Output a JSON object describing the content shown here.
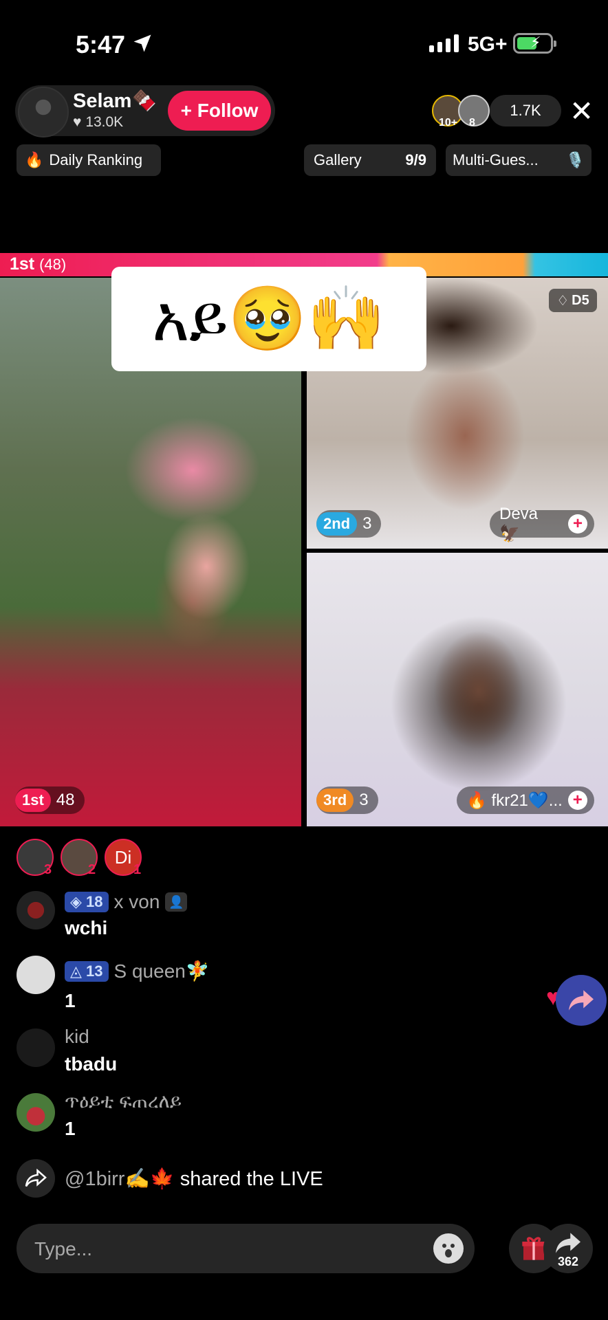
{
  "status": {
    "time": "5:47",
    "network": "5G+"
  },
  "host": {
    "name": "Selam🍫",
    "likes": "13.0K",
    "follow_label": "+ Follow"
  },
  "viewers": {
    "count": "1.7K",
    "badge_a": "10+",
    "badge_b": "8"
  },
  "chips": {
    "daily_ranking": "Daily Ranking",
    "gallery": "Gallery",
    "gallery_count": "9/9",
    "multi_guest": "Multi-Gues..."
  },
  "battle": {
    "leader": "1st",
    "leader_score": "(48)"
  },
  "sticker_text": "አይ🥹🙌",
  "tiles": {
    "main": {
      "rank": "1st",
      "score": "48"
    },
    "second": {
      "rank": "2nd",
      "score": "3",
      "name": "Deva 🦅",
      "badge": "D5"
    },
    "third": {
      "rank": "3rd",
      "score": "3",
      "name": "🔥 fkr21💙..."
    }
  },
  "gifters": [
    {
      "count": "3"
    },
    {
      "count": "2"
    },
    {
      "initials": "Di",
      "count": "1"
    }
  ],
  "comments": [
    {
      "level": "18",
      "user": "x von",
      "text": "wchi"
    },
    {
      "level": "13",
      "user": "S queen🧚",
      "text": "1"
    },
    {
      "user": "kid",
      "text": "tbadu"
    },
    {
      "user": "ጥዕይቲ ፍጠረለይ",
      "text": "1"
    }
  ],
  "share_event": {
    "user": "@1birr✍️🍁",
    "text": "shared the LIVE"
  },
  "input": {
    "placeholder": "Type..."
  },
  "share_count": "362",
  "colors": {
    "accent": "#ee1d52",
    "second": "#2aa9e0",
    "third": "#f08a24"
  }
}
